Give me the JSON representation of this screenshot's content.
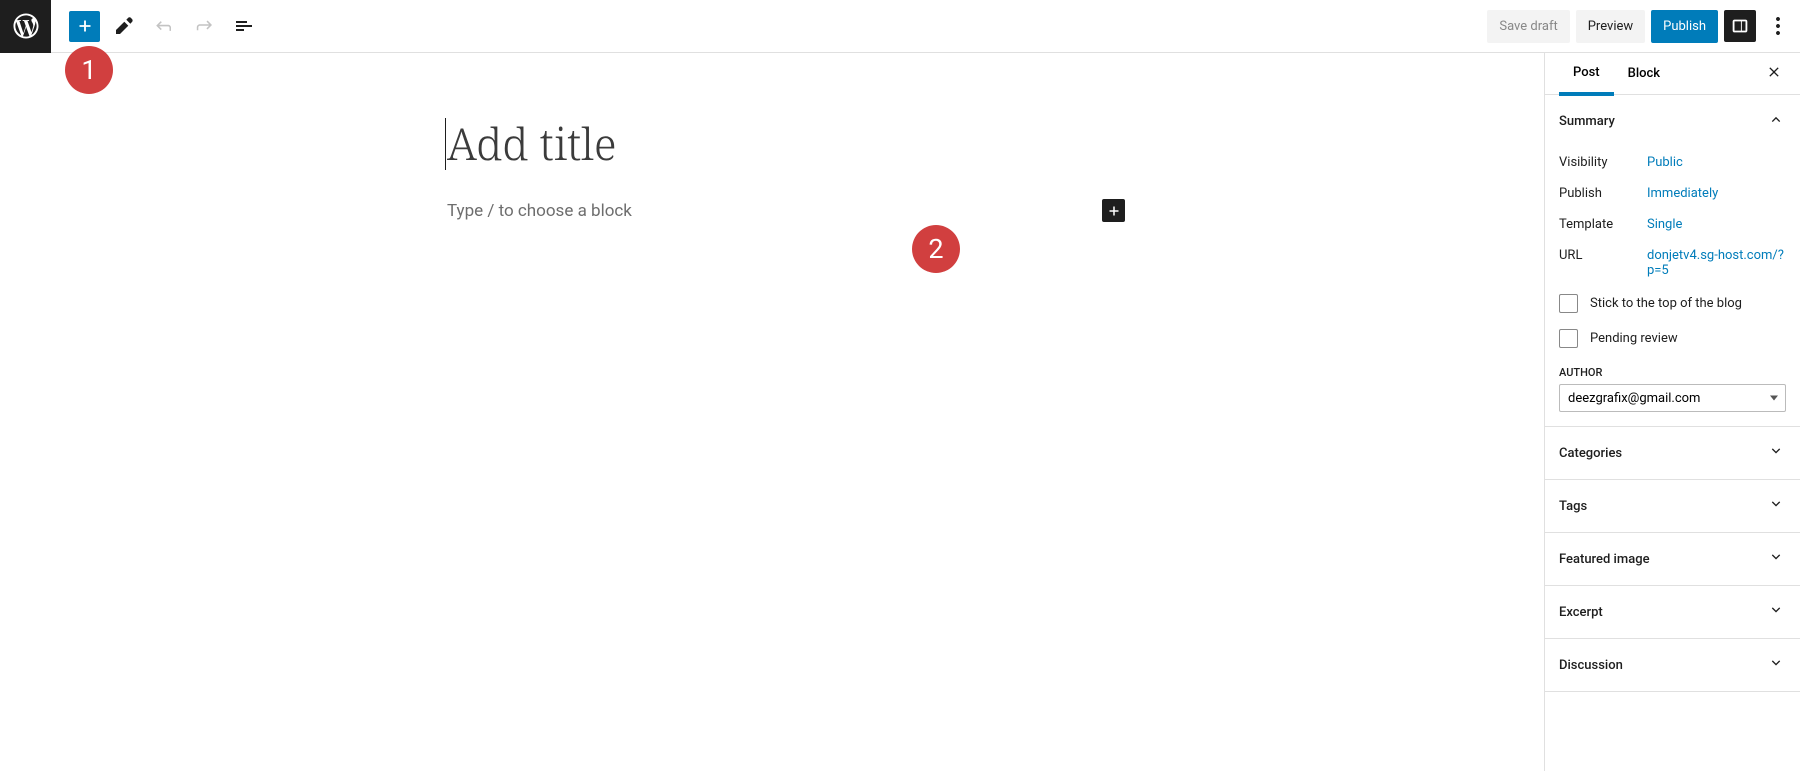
{
  "toolbar": {
    "save_draft": "Save draft",
    "preview": "Preview",
    "publish": "Publish"
  },
  "editor": {
    "title_placeholder": "Add title",
    "block_placeholder": "Type / to choose a block"
  },
  "markers": {
    "m1": "1",
    "m2": "2"
  },
  "sidebar": {
    "tabs": {
      "post": "Post",
      "block": "Block"
    },
    "summary": {
      "title": "Summary",
      "visibility_label": "Visibility",
      "visibility_value": "Public",
      "publish_label": "Publish",
      "publish_value": "Immediately",
      "template_label": "Template",
      "template_value": "Single",
      "url_label": "URL",
      "url_value": "donjetv4.sg-host.com/?p=5",
      "sticky": "Stick to the top of the blog",
      "pending": "Pending review",
      "author_label": "AUTHOR",
      "author_value": "deezgrafix@gmail.com"
    },
    "panels": {
      "categories": "Categories",
      "tags": "Tags",
      "featured_image": "Featured image",
      "excerpt": "Excerpt",
      "discussion": "Discussion"
    }
  }
}
